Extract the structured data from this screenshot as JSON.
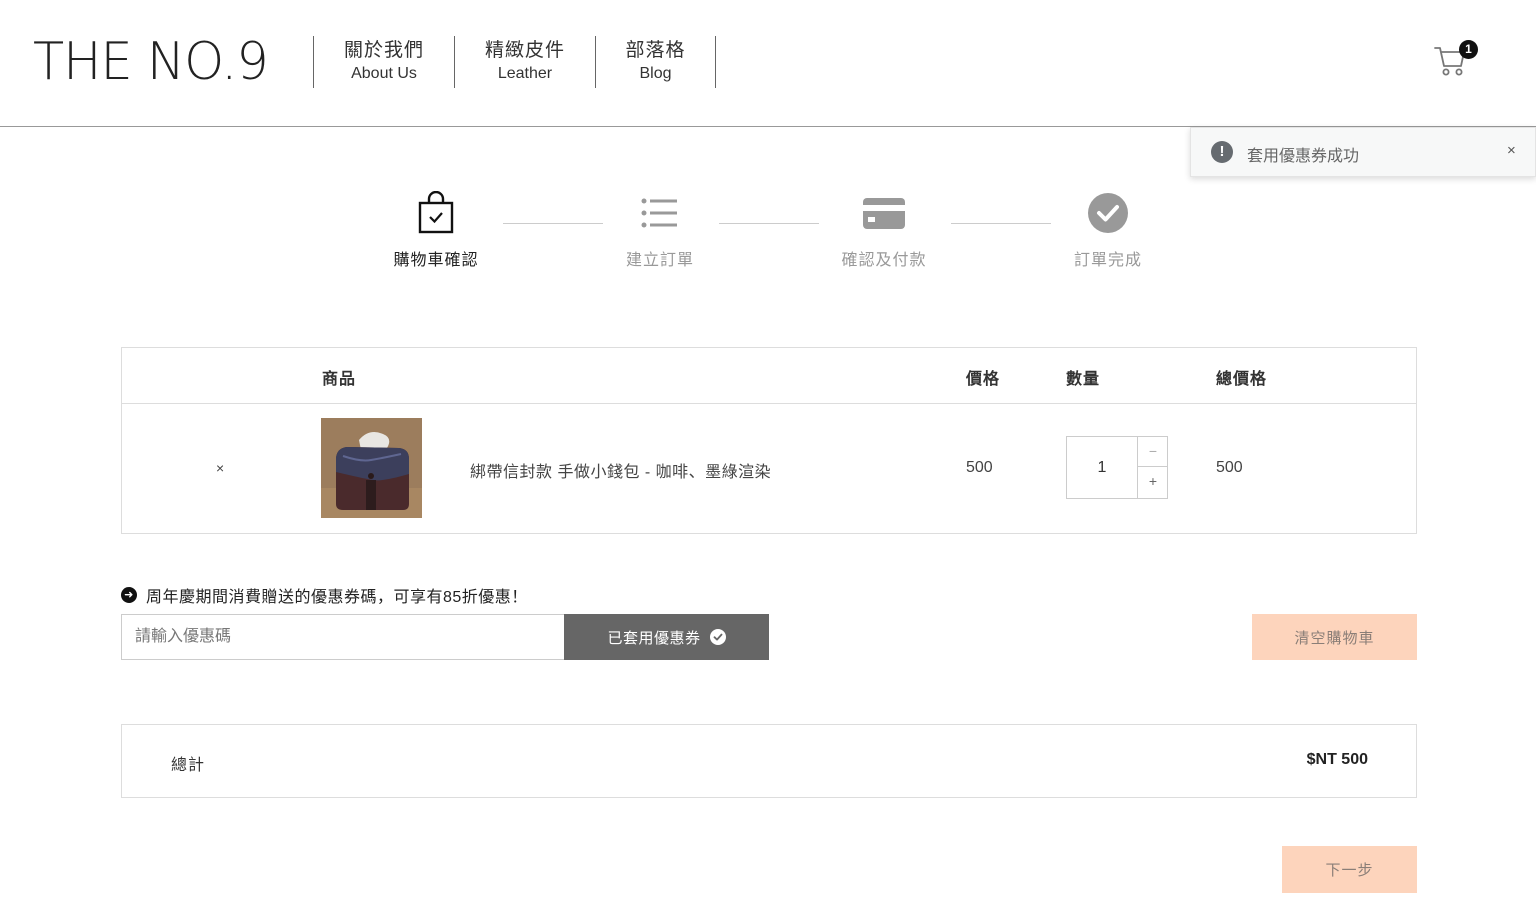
{
  "header": {
    "logo": "THE NO.9",
    "nav": [
      {
        "zh": "關於我們",
        "en": "About Us"
      },
      {
        "zh": "精緻皮件",
        "en": "Leather"
      },
      {
        "zh": "部落格",
        "en": "Blog"
      }
    ],
    "cart_count": "1"
  },
  "toast": {
    "message": "套用優惠券成功",
    "icon": "!",
    "close": "×"
  },
  "steps": [
    {
      "label": "購物車確認",
      "icon": "shopping-bag-check",
      "active": true
    },
    {
      "label": "建立訂單",
      "icon": "list",
      "active": false
    },
    {
      "label": "確認及付款",
      "icon": "credit-card",
      "active": false
    },
    {
      "label": "訂單完成",
      "icon": "check-circle",
      "active": false
    }
  ],
  "table": {
    "headers": {
      "product": "商品",
      "price": "價格",
      "quantity": "數量",
      "subtotal": "總價格"
    },
    "rows": [
      {
        "remove": "×",
        "name": "綁帶信封款 手做小錢包 - 咖啡、墨綠渲染",
        "price": "500",
        "quantity": "1",
        "subtotal": "500"
      }
    ],
    "qty_minus": "−",
    "qty_plus": "+"
  },
  "coupon": {
    "hint": "周年慶期間消費贈送的優惠券碼，可享有85折優惠！",
    "placeholder": "請輸入優惠碼",
    "applied_label": "已套用優惠券",
    "clear_cart_label": "清空購物車"
  },
  "total": {
    "label": "總計",
    "value": "$NT 500"
  },
  "next_label": "下一步",
  "colors": {
    "accent_peach": "#fdd4bc",
    "button_gray": "#666666",
    "toast_bg": "#f7f8f8"
  }
}
